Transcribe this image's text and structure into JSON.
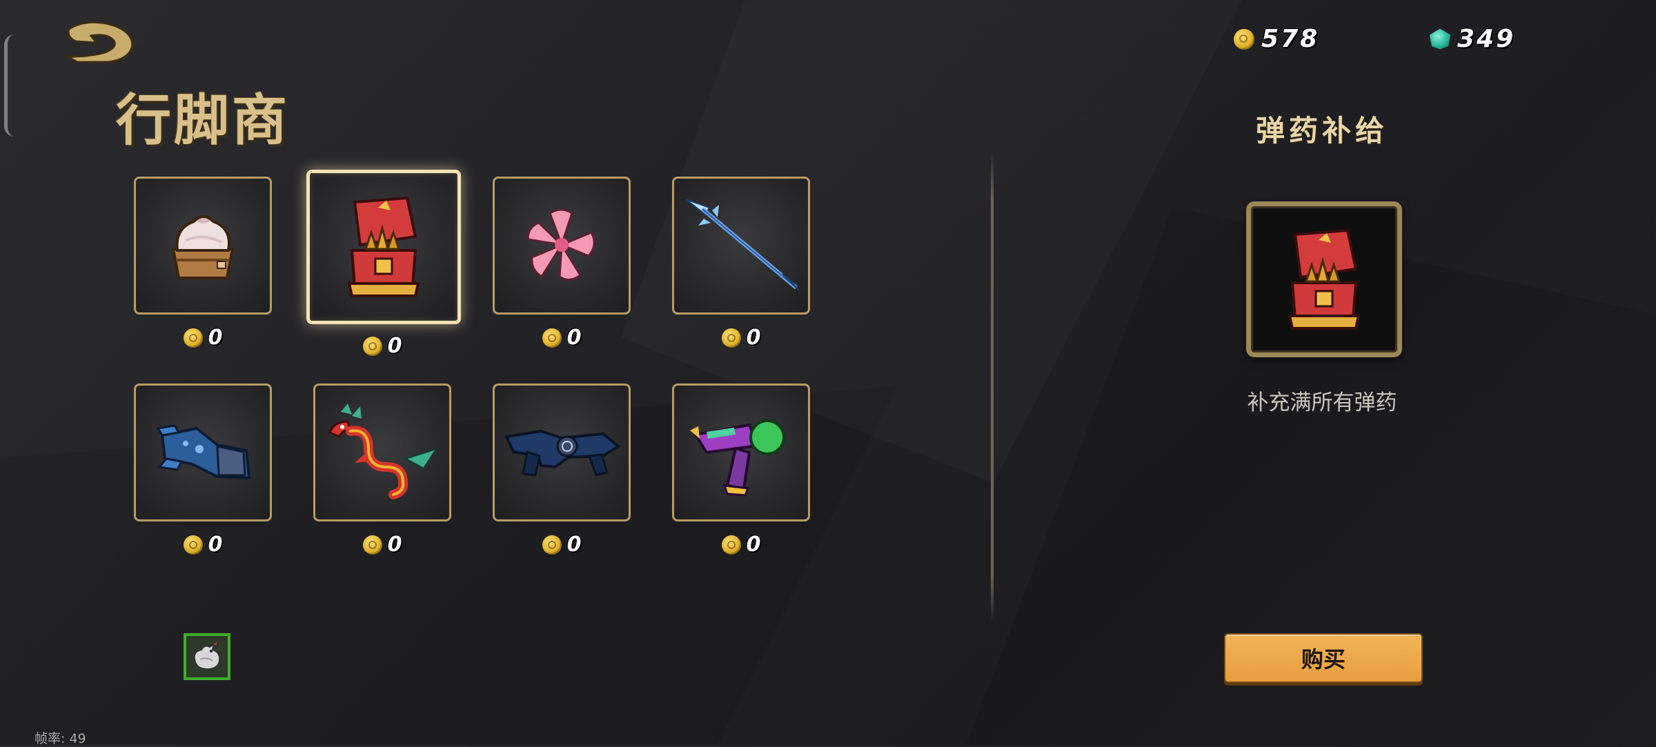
{
  "shop": {
    "title": "行脚商"
  },
  "currency": {
    "coins": "578",
    "gems": "349"
  },
  "items": [
    {
      "name": "steamed-bun",
      "price": "0",
      "selected": false
    },
    {
      "name": "ammo-chest",
      "price": "0",
      "selected": true
    },
    {
      "name": "cherry-blossom",
      "price": "0",
      "selected": false
    },
    {
      "name": "ice-spear",
      "price": "0",
      "selected": false
    },
    {
      "name": "gauntlet",
      "price": "0",
      "selected": false
    },
    {
      "name": "dragon",
      "price": "0",
      "selected": false
    },
    {
      "name": "blue-rifle",
      "price": "0",
      "selected": false
    },
    {
      "name": "purple-blaster",
      "price": "0",
      "selected": false
    }
  ],
  "detail": {
    "title": "弹药补给",
    "description": "补充满所有弹药",
    "icon": "ammo-chest-icon"
  },
  "buy": {
    "label": "购买"
  },
  "fps": {
    "text": "帧率: 49"
  },
  "colors": {
    "frame": "#b89c64",
    "selected_frame": "#f3e2b4",
    "button": "#e9a545",
    "coin": "#e0b22a",
    "gem": "#23b597"
  }
}
